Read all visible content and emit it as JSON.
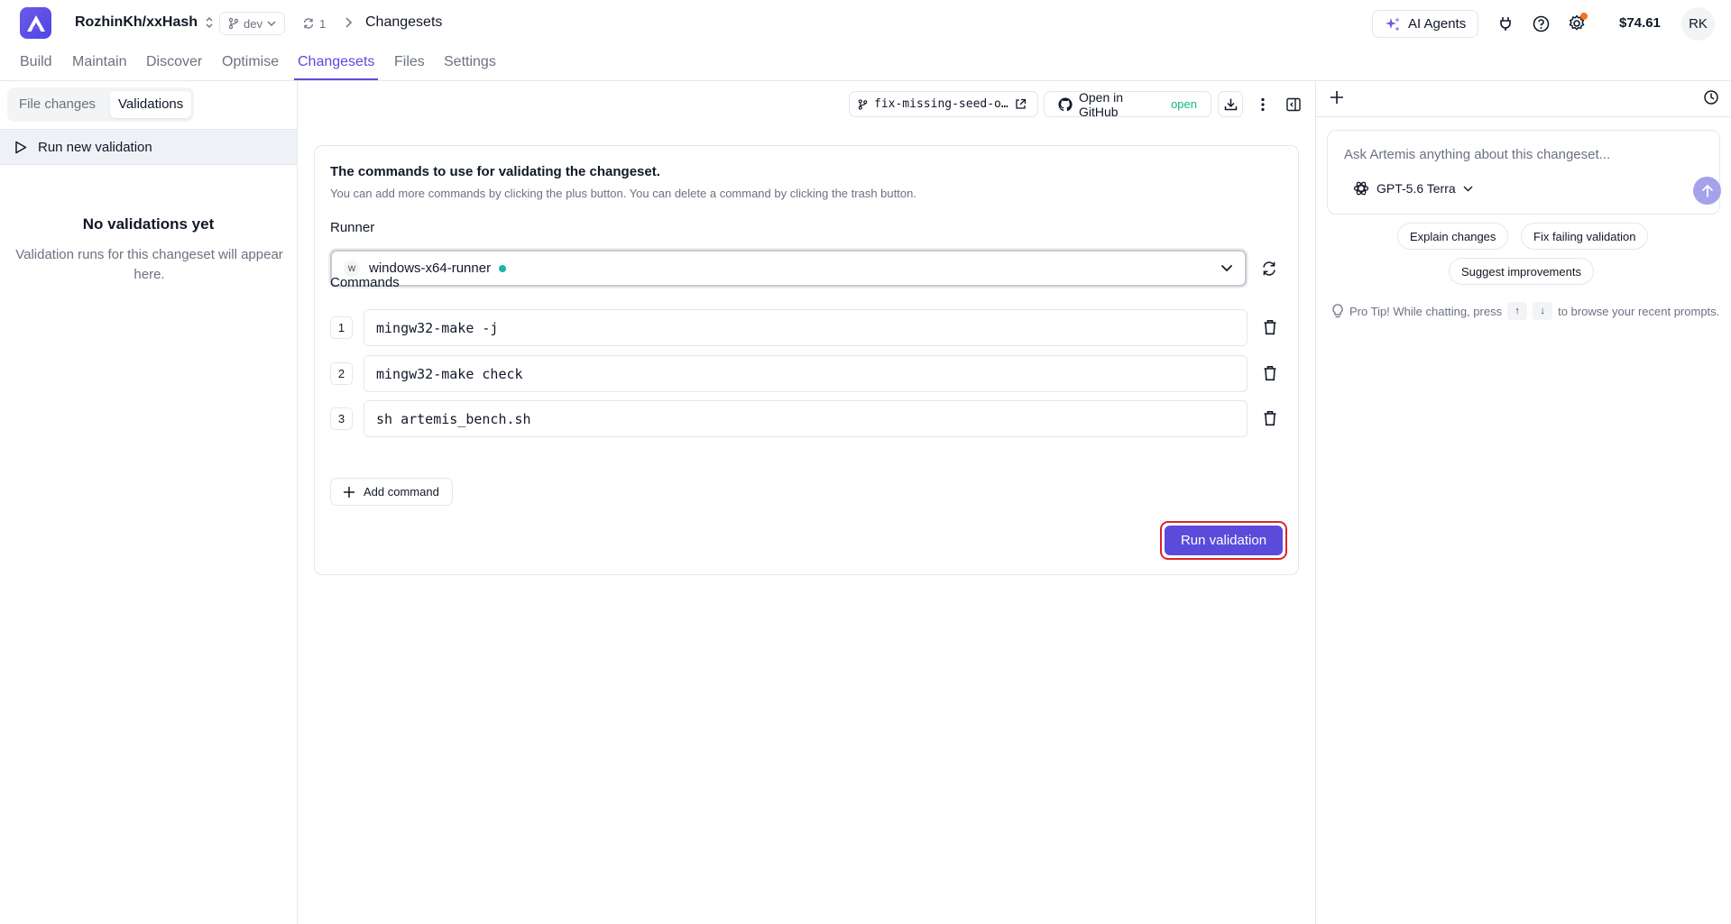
{
  "header": {
    "repo": "RozhinKh/xxHash",
    "branch": "dev",
    "sync_count": "1",
    "breadcrumb_current": "Changesets",
    "ai_agents_label": "AI Agents",
    "balance": "$74.61",
    "avatar_initials": "RK"
  },
  "nav": {
    "tabs": [
      {
        "label": "Build"
      },
      {
        "label": "Maintain"
      },
      {
        "label": "Discover"
      },
      {
        "label": "Optimise"
      },
      {
        "label": "Changesets",
        "active": true
      },
      {
        "label": "Files"
      },
      {
        "label": "Settings"
      }
    ]
  },
  "left_panel": {
    "tabs": [
      {
        "label": "File changes"
      },
      {
        "label": "Validations",
        "active": true
      }
    ],
    "run_new_label": "Run new validation",
    "empty_title": "No validations yet",
    "empty_subtitle": "Validation runs for this changeset will appear here."
  },
  "toolbar": {
    "branch_name": "fix-missing-seed-o…",
    "github_label": "Open in GitHub",
    "github_status": "open"
  },
  "validation_form": {
    "title": "The commands to use for validating the changeset.",
    "subtitle": "You can add more commands by clicking the plus button. You can delete a command by clicking the trash button.",
    "runner_label": "Runner",
    "runner": {
      "badge": "W",
      "name": "windows-x64-runner",
      "status": "online"
    },
    "commands_label": "Commands",
    "commands": [
      {
        "num": "1",
        "value": "mingw32-make -j"
      },
      {
        "num": "2",
        "value": "mingw32-make check"
      },
      {
        "num": "3",
        "value": "sh artemis_bench.sh"
      }
    ],
    "add_command_label": "Add command",
    "run_button_label": "Run validation"
  },
  "chat": {
    "placeholder": "Ask Artemis anything about this changeset...",
    "model": "GPT-5.6 Terra",
    "suggestions": [
      "Explain changes",
      "Fix failing validation",
      "Suggest improvements"
    ],
    "protip_prefix": "Pro Tip! While chatting, press",
    "protip_key_up": "↑",
    "protip_key_down": "↓",
    "protip_suffix": "to browse your recent prompts."
  },
  "colors": {
    "accent": "#5b4bdb",
    "status_online": "#14b8a6",
    "github_open": "#10b981",
    "highlight_border": "#dc2626",
    "notification_dot": "#f97316"
  },
  "icons": [
    "logo-icon",
    "chevron-updown-icon",
    "git-branch-icon",
    "chevron-down-icon",
    "sync-icon",
    "chevron-right-icon",
    "sparkle-icon",
    "plug-icon",
    "help-icon",
    "gear-icon",
    "play-icon",
    "external-link-icon",
    "github-icon",
    "download-icon",
    "more-vertical-icon",
    "panel-toggle-icon",
    "refresh-icon",
    "trash-icon",
    "plus-icon",
    "history-icon",
    "openai-icon",
    "send-arrow-icon",
    "lightbulb-icon"
  ]
}
